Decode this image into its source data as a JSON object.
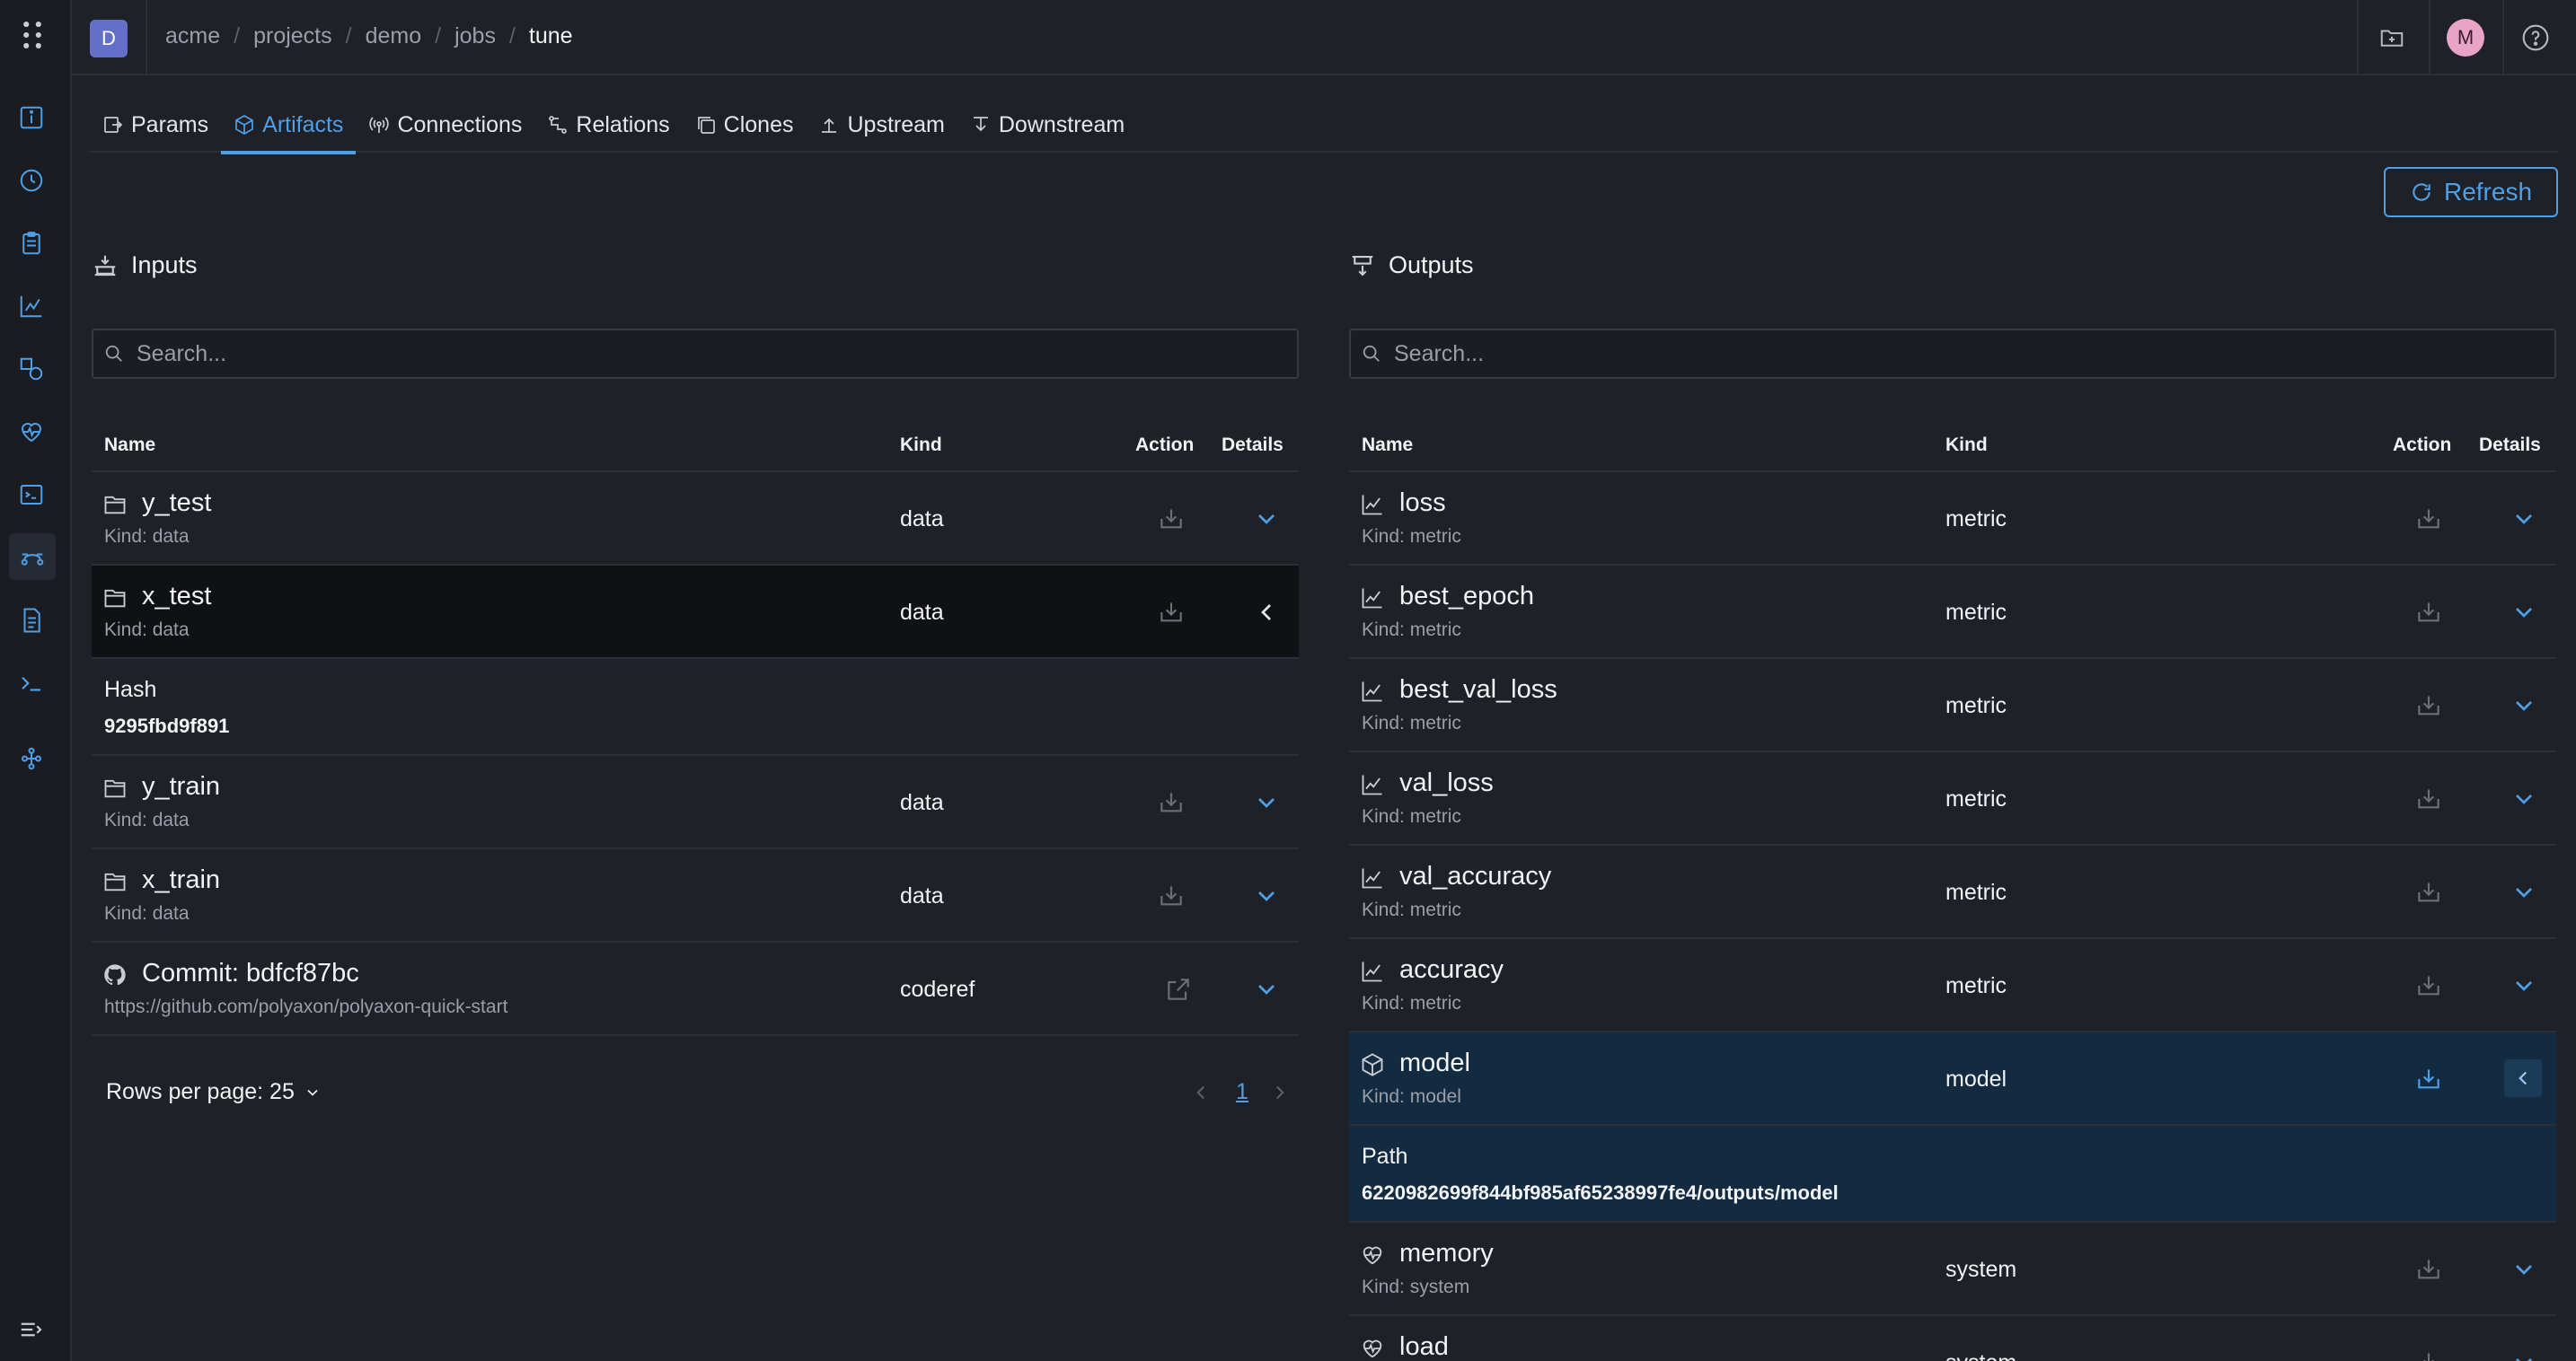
{
  "topbar": {
    "org_avatar": "D",
    "breadcrumb": [
      "acme",
      "projects",
      "demo",
      "jobs",
      "tune"
    ],
    "user_avatar": "M"
  },
  "tabs": [
    "Params",
    "Artifacts",
    "Connections",
    "Relations",
    "Clones",
    "Upstream",
    "Downstream"
  ],
  "refresh_label": "Refresh",
  "inputs": {
    "title": "Inputs",
    "search_placeholder": "Search...",
    "headers": {
      "name": "Name",
      "kind": "Kind",
      "action": "Action",
      "details": "Details"
    },
    "rows": [
      {
        "name": "y_test",
        "sub": "Kind: data",
        "kind": "data"
      },
      {
        "name": "x_test",
        "sub": "Kind: data",
        "kind": "data"
      },
      {
        "name": "y_train",
        "sub": "Kind: data",
        "kind": "data"
      },
      {
        "name": "x_train",
        "sub": "Kind: data",
        "kind": "data"
      },
      {
        "name": "Commit: bdfcf87bc",
        "sub": "https://github.com/polyaxon/polyaxon-quick-start",
        "kind": "coderef"
      }
    ],
    "expanded": {
      "label": "Hash",
      "value": "9295fbd9f891"
    },
    "pagination": {
      "rows_per_page": "Rows per page: 25",
      "page": "1"
    }
  },
  "outputs": {
    "title": "Outputs",
    "search_placeholder": "Search...",
    "headers": {
      "name": "Name",
      "kind": "Kind",
      "action": "Action",
      "details": "Details"
    },
    "rows": [
      {
        "name": "loss",
        "sub": "Kind: metric",
        "kind": "metric"
      },
      {
        "name": "best_epoch",
        "sub": "Kind: metric",
        "kind": "metric"
      },
      {
        "name": "best_val_loss",
        "sub": "Kind: metric",
        "kind": "metric"
      },
      {
        "name": "val_loss",
        "sub": "Kind: metric",
        "kind": "metric"
      },
      {
        "name": "val_accuracy",
        "sub": "Kind: metric",
        "kind": "metric"
      },
      {
        "name": "accuracy",
        "sub": "Kind: metric",
        "kind": "metric"
      },
      {
        "name": "model",
        "sub": "Kind: model",
        "kind": "model"
      },
      {
        "name": "memory",
        "sub": "Kind: system",
        "kind": "system"
      },
      {
        "name": "load",
        "sub": "",
        "kind": "system"
      }
    ],
    "expanded": {
      "label": "Path",
      "value": "6220982699f844bf985af65238997fe4/outputs/model"
    }
  }
}
